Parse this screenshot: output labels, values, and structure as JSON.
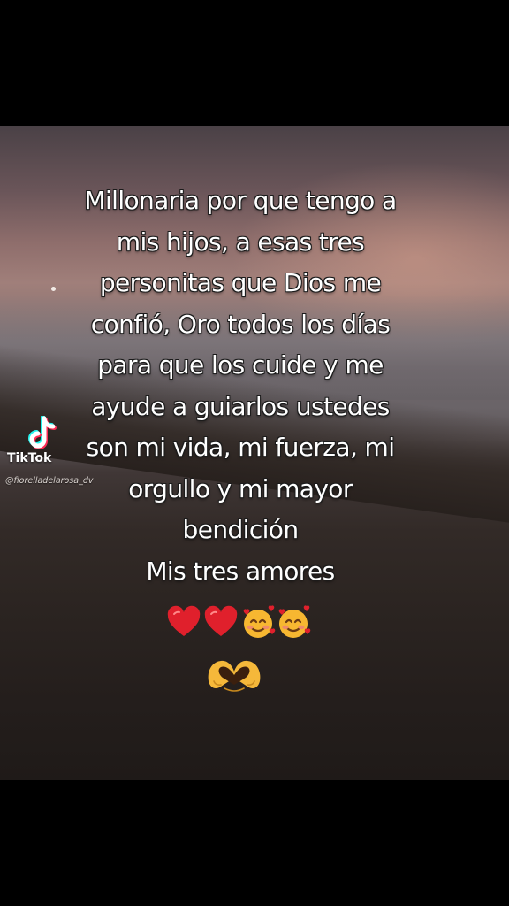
{
  "quote_lines": [
    "Millonaria por que tengo a",
    "mis hijos, a esas tres",
    "personitas que Dios me",
    "confió, Oro todos los días",
    "para que los cuide y me",
    "ayude a guiarlos ustedes",
    "son mi vida, mi fuerza, mi",
    "orgullo y mi mayor",
    "bendición",
    "Mis  tres  amores"
  ],
  "watermark": {
    "brand": "TikTok",
    "handle": "@fiorelladelarosa_dv",
    "icon": "tiktok-logo-icon"
  },
  "emojis": {
    "row": [
      "red-heart-icon",
      "red-heart-icon",
      "smiling-face-with-hearts-icon",
      "smiling-face-with-hearts-icon"
    ],
    "second_row": [
      "heart-hands-icon"
    ]
  },
  "colors": {
    "text": "#ffffff",
    "heart": "#e0202c",
    "emoji_face": "#f7b731",
    "letterbox": "#000000"
  }
}
